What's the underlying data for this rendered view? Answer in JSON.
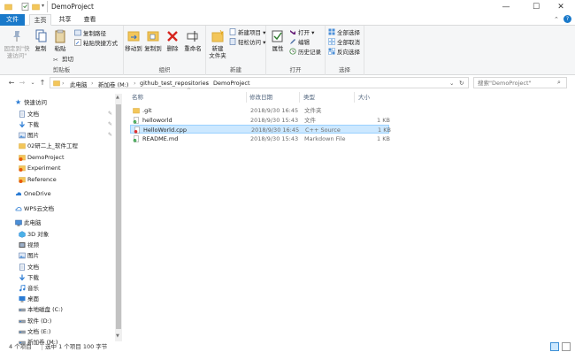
{
  "window": {
    "title": "DemoProject",
    "controls": {
      "minimize": "—",
      "maximize": "☐",
      "close": "✕"
    }
  },
  "ribbon_tabs": [
    {
      "label": "文件",
      "active": false
    },
    {
      "label": "主页",
      "active": true
    },
    {
      "label": "共享",
      "active": false
    },
    {
      "label": "查看",
      "active": false
    }
  ],
  "ribbon": {
    "clipboard": {
      "label": "剪贴板",
      "pin_label_1": "固定到\"快",
      "pin_label_2": "速访问\"",
      "copy": "复制",
      "paste": "粘贴",
      "copy_path": "复制路径",
      "paste_shortcut": "粘贴快捷方式",
      "cut": "剪切"
    },
    "organize": {
      "label": "组织",
      "move_to": "移动到",
      "copy_to": "复制到",
      "delete": "删除",
      "rename": "重命名"
    },
    "new": {
      "label": "新建",
      "new_item": "新建项目 ▾",
      "easy_access": "轻松访问 ▾",
      "new_folder_1": "新建",
      "new_folder_2": "文件夹"
    },
    "open": {
      "label": "打开",
      "properties": "属性",
      "open": "打开 ▾",
      "edit": "编辑",
      "history": "历史记录"
    },
    "select": {
      "label": "选择",
      "select_all": "全部选择",
      "select_none": "全部取消",
      "invert": "反向选择"
    }
  },
  "address": {
    "crumbs": [
      "此电脑",
      "新加卷 (M:)",
      "github_test_repositories",
      "DemoProject"
    ],
    "search_placeholder": "搜索\"DemoProject\""
  },
  "nav_pane": {
    "quick_access": "快速访问",
    "items": [
      {
        "label": "文档",
        "icon": "document-icon",
        "pinned": true
      },
      {
        "label": "下载",
        "icon": "download-icon",
        "pinned": true
      },
      {
        "label": "图片",
        "icon": "picture-icon",
        "pinned": true
      },
      {
        "label": "02研二上_软件工程",
        "icon": "folder-icon",
        "pinned": false
      },
      {
        "label": "DemoProject",
        "icon": "git-folder-icon",
        "pinned": false
      },
      {
        "label": "Experiment",
        "icon": "git-folder-icon",
        "pinned": false
      },
      {
        "label": "Reference",
        "icon": "git-folder-icon",
        "pinned": false
      }
    ],
    "onedrive": "OneDrive",
    "wps": "WPS云文档",
    "this_pc": "此电脑",
    "pc_items": [
      {
        "label": "3D 对象",
        "icon": "cube-icon"
      },
      {
        "label": "视频",
        "icon": "video-icon"
      },
      {
        "label": "图片",
        "icon": "picture-icon"
      },
      {
        "label": "文档",
        "icon": "document-icon"
      },
      {
        "label": "下载",
        "icon": "download-icon"
      },
      {
        "label": "音乐",
        "icon": "music-icon"
      },
      {
        "label": "桌面",
        "icon": "desktop-icon"
      },
      {
        "label": "本地磁盘 (C:)",
        "icon": "drive-icon"
      },
      {
        "label": "软件 (D:)",
        "icon": "drive-icon"
      },
      {
        "label": "文档 (E:)",
        "icon": "drive-icon"
      },
      {
        "label": "新加卷 (M:)",
        "icon": "drive-icon"
      }
    ]
  },
  "columns": {
    "name": "名称",
    "date": "修改日期",
    "type": "类型",
    "size": "大小"
  },
  "files": [
    {
      "name": ".git",
      "date": "2018/9/30 16:45",
      "type": "文件夹",
      "size": "",
      "icon": "folder-icon",
      "selected": false
    },
    {
      "name": "helloworld",
      "date": "2018/9/30 15:43",
      "type": "文件",
      "size": "1 KB",
      "icon": "git-file-icon",
      "selected": false
    },
    {
      "name": "HelloWorld.cpp",
      "date": "2018/9/30 16:45",
      "type": "C++ Source",
      "size": "1 KB",
      "icon": "git-modified-icon",
      "selected": true
    },
    {
      "name": "README.md",
      "date": "2018/9/30 15:43",
      "type": "Markdown File",
      "size": "1 KB",
      "icon": "git-file-icon",
      "selected": false
    }
  ],
  "status": {
    "count": "4 个项目",
    "selection": "选中 1 个项目  100 字节"
  },
  "colors": {
    "accent": "#1979ca",
    "selection": "#cce8ff",
    "selection_border": "#99d1ff",
    "ribbon_bg": "#f5f6f7"
  }
}
